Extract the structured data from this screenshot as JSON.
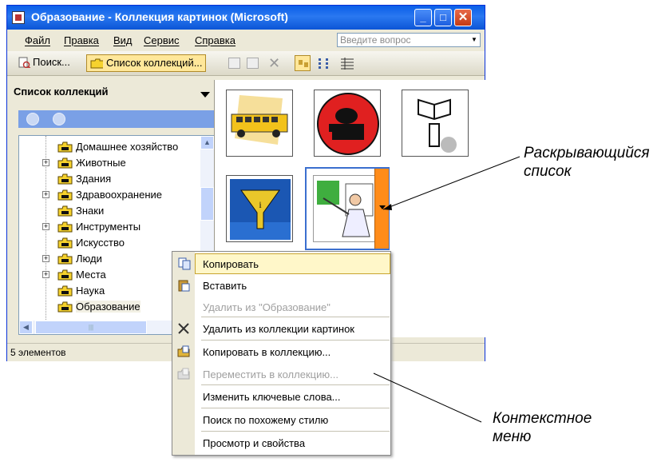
{
  "window": {
    "title": "Образование - Коллекция картинок (Microsoft)",
    "min_glyph": "_",
    "max_glyph": "□",
    "close_glyph": "✕"
  },
  "menubar": {
    "items": [
      "Файл",
      "Правка",
      "Вид",
      "Сервис",
      "Справка"
    ],
    "ask_placeholder": "Введите вопрос"
  },
  "toolbar": {
    "search_label": "Поиск...",
    "collections_label": "Список коллекций..."
  },
  "left_pane": {
    "header": "Список коллекций",
    "tree": [
      {
        "label": "Домашнее хозяйство",
        "expandable": false
      },
      {
        "label": "Животные",
        "expandable": true
      },
      {
        "label": "Здания",
        "expandable": false
      },
      {
        "label": "Здравоохранение",
        "expandable": true
      },
      {
        "label": "Знаки",
        "expandable": false
      },
      {
        "label": "Инструменты",
        "expandable": true
      },
      {
        "label": "Искусство",
        "expandable": false
      },
      {
        "label": "Люди",
        "expandable": true
      },
      {
        "label": "Места",
        "expandable": true
      },
      {
        "label": "Наука",
        "expandable": false
      },
      {
        "label": "Образование",
        "expandable": false,
        "selected": true
      }
    ]
  },
  "statusbar": {
    "text": "5 элементов"
  },
  "context_menu": {
    "items": [
      {
        "label": "Копировать",
        "icon": "copy-icon",
        "enabled": true,
        "highlighted": true
      },
      {
        "label": "Вставить",
        "icon": "paste-icon",
        "enabled": true
      },
      {
        "label": "Удалить из \"Образование\"",
        "icon": "",
        "enabled": false
      },
      {
        "label": "Удалить из коллекции картинок",
        "icon": "delete-x-icon",
        "enabled": true
      },
      {
        "label": "Копировать в коллекцию...",
        "icon": "copy-to-collection-icon",
        "enabled": true
      },
      {
        "label": "Переместить в коллекцию...",
        "icon": "move-to-collection-icon",
        "enabled": false
      },
      {
        "label": "Изменить ключевые слова...",
        "icon": "",
        "enabled": true
      },
      {
        "label": "Поиск по похожему стилю",
        "icon": "",
        "enabled": true
      },
      {
        "label": "Просмотр и свойства",
        "icon": "",
        "enabled": true
      }
    ]
  },
  "callouts": {
    "dropdown": [
      "Раскрывающийся",
      "список"
    ],
    "context_menu": [
      "Контекстное",
      "меню"
    ]
  },
  "colors": {
    "titlebar": "#0a5ee8",
    "dropdown_button": "#ff8c1a",
    "highlight": "#fff7c9"
  }
}
